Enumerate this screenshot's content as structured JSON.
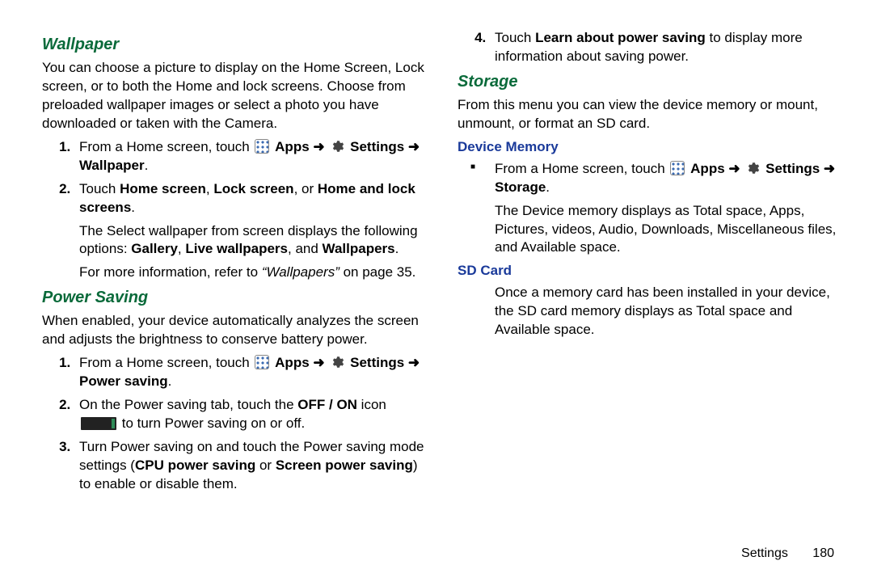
{
  "arrow": "➜",
  "labels": {
    "apps": "Apps",
    "settings": "Settings"
  },
  "wallpaper": {
    "heading": "Wallpaper",
    "intro": "You can choose a picture to display on the Home Screen, Lock screen, or to both the Home and lock screens. Choose from preloaded wallpaper images or select a photo you have downloaded or taken with the Camera.",
    "step1_pre": "From a Home screen, touch ",
    "step1_tail": " Wallpaper",
    "step2a": "Touch ",
    "step2_home": "Home screen",
    "step2_sep1": ", ",
    "step2_lock": "Lock screen",
    "step2_sep2": ", or ",
    "step2_both": "Home and lock screens",
    "step2_end": ".",
    "step2_para_a": "The Select wallpaper from screen displays the following options: ",
    "opt_gallery": "Gallery",
    "sep_comma": ", ",
    "opt_live": "Live wallpapers",
    "sep_and": ", and ",
    "opt_wall": "Wallpapers",
    "period": ".",
    "more_a": "For more information, refer to ",
    "more_ref": "“Wallpapers”",
    "more_b": "  on page 35."
  },
  "power": {
    "heading": "Power Saving",
    "intro": "When enabled, your device automatically analyzes the screen and adjusts the brightness to conserve battery power.",
    "s1_pre": "From a Home screen, touch ",
    "s1_tail": " Power saving",
    "s2_a": "On the Power saving tab, touch the ",
    "s2_offon": "OFF / ON",
    "s2_b": " icon ",
    "s2_c": " to turn Power saving on or off.",
    "s3_a": "Turn Power saving on and touch the Power saving mode settings (",
    "s3_cpu": "CPU power saving",
    "s3_or": " or ",
    "s3_scr": "Screen power saving",
    "s3_b": ") to enable or disable them.",
    "s4_a": "Touch ",
    "s4_learn": "Learn about power saving",
    "s4_b": " to display more information about saving power."
  },
  "storage": {
    "heading": "Storage",
    "intro": "From this menu you can view the device memory or mount, unmount, or format an SD card.",
    "devmem_h": "Device Memory",
    "dm_pre": "From a Home screen, touch ",
    "dm_tail": " Storage",
    "dm_para": "The Device memory displays as Total space, Apps, Pictures, videos, Audio, Downloads, Miscellaneous files, and Available space.",
    "sd_h": "SD Card",
    "sd_para": "Once a memory card has been installed in your device, the SD card memory displays as Total space and Available space."
  },
  "footer": {
    "section": "Settings",
    "page": "180"
  }
}
